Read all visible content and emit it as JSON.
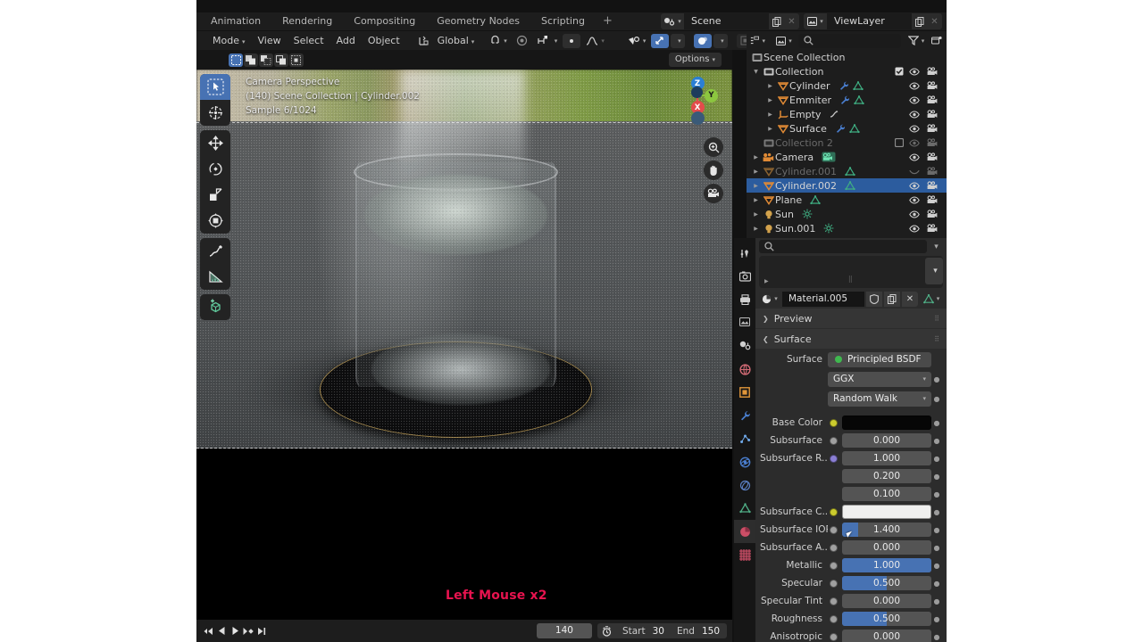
{
  "workspace_tabs": [
    {
      "label": "Animation"
    },
    {
      "label": "Rendering"
    },
    {
      "label": "Compositing"
    },
    {
      "label": "Geometry Nodes"
    },
    {
      "label": "Scripting"
    },
    {
      "label": "+"
    }
  ],
  "scene_selector": {
    "icon": "scene-icon",
    "value": "Scene",
    "new_btn": "copy-icon",
    "unlink_btn": "✕"
  },
  "viewlayer_selector": {
    "icon": "viewlayer-icon",
    "value": "ViewLayer",
    "new_btn": "copy-icon",
    "unlink_btn": "✕"
  },
  "viewport_header": {
    "mode": "Mode",
    "menus": [
      "View",
      "Select",
      "Add",
      "Object"
    ],
    "transform_orientation": "Global",
    "shading_modes": [
      "wireframe",
      "solid",
      "material-preview",
      "rendered"
    ],
    "active_shading": "rendered"
  },
  "tool_header": {
    "select_modes": [
      "set",
      "extend",
      "subtract",
      "invert",
      "intersect"
    ],
    "active_select_mode": "set",
    "options_label": "Options"
  },
  "viewport_overlay": {
    "line1": "Camera Perspective",
    "line2": "(140) Scene Collection | Cylinder.002",
    "line3": "Sample 6/1024"
  },
  "annotation": {
    "text": "Left Mouse x2",
    "color": "#e8134f"
  },
  "gizmo": {
    "axes": [
      "Z",
      "Y",
      "X"
    ],
    "colors": {
      "z": "#2b7fd4",
      "y": "#8cc63f",
      "x": "#e34b4b"
    }
  },
  "toolbar": {
    "tools": [
      {
        "name": "tweak-tool",
        "active": true
      },
      {
        "name": "cursor-tool",
        "active": false
      },
      {
        "name": "move-tool",
        "active": false
      },
      {
        "name": "rotate-tool",
        "active": false
      },
      {
        "name": "scale-tool",
        "active": false
      },
      {
        "name": "transform-tool",
        "active": false
      },
      {
        "name": "annotate-tool",
        "active": false
      },
      {
        "name": "measure-tool",
        "active": false
      },
      {
        "name": "add-cube-tool",
        "active": false
      }
    ]
  },
  "timeline": {
    "buttons": [
      "jump-to-start",
      "play-reverse",
      "play",
      "jump-to-keyframe",
      "jump-to-end"
    ],
    "current_frame": "140",
    "start_label": "Start",
    "start_value": "30",
    "end_label": "End",
    "end_value": "150"
  },
  "outliner": {
    "search_placeholder": "",
    "root": "Scene Collection",
    "rows": [
      {
        "indent": 0,
        "disclosure": "▼",
        "icon": "collection-icon",
        "icon_color": "#c8c8c8",
        "name": "Collection",
        "mods": [],
        "checkbox": true,
        "eye": true,
        "camera": true,
        "dim": false,
        "selected": false
      },
      {
        "indent": 1,
        "disclosure": "▶",
        "icon": "mesh-icon",
        "icon_color": "#e08a35",
        "name": "Cylinder",
        "mods": [
          "modifier-icon",
          "mesh-data-icon"
        ],
        "checkbox": false,
        "eye": true,
        "camera": true,
        "dim": false,
        "selected": false
      },
      {
        "indent": 1,
        "disclosure": "▶",
        "icon": "mesh-icon",
        "icon_color": "#e08a35",
        "name": "Emmiter",
        "mods": [
          "modifier-icon",
          "mesh-data-icon"
        ],
        "checkbox": false,
        "eye": true,
        "camera": true,
        "dim": false,
        "selected": false
      },
      {
        "indent": 1,
        "disclosure": "▶",
        "icon": "empty-icon",
        "icon_color": "#e08a35",
        "name": "Empty",
        "mods": [
          "constraint-icon"
        ],
        "checkbox": false,
        "eye": true,
        "camera": true,
        "dim": false,
        "selected": false
      },
      {
        "indent": 1,
        "disclosure": "▶",
        "icon": "mesh-icon",
        "icon_color": "#e08a35",
        "name": "Surface",
        "mods": [
          "modifier-icon",
          "mesh-data-icon"
        ],
        "checkbox": false,
        "eye": true,
        "camera": true,
        "dim": false,
        "selected": false
      },
      {
        "indent": 0,
        "disclosure": "",
        "icon": "collection-icon",
        "icon_color": "#7a7a7a",
        "name": "Collection 2",
        "mods": [],
        "checkbox": true,
        "eye": true,
        "camera": true,
        "dim": true,
        "selected": false
      },
      {
        "indent": 0,
        "disclosure": "▶",
        "icon": "camera-icon",
        "icon_color": "#e08a35",
        "name": "Camera",
        "mods": [
          "camera-data-icon"
        ],
        "checkbox": false,
        "eye": true,
        "camera": true,
        "dim": false,
        "selected": false
      },
      {
        "indent": 0,
        "disclosure": "▶",
        "icon": "mesh-icon",
        "icon_color": "#8a6230",
        "name": "Cylinder.001",
        "mods": [
          "mesh-data-icon"
        ],
        "checkbox": false,
        "eye": false,
        "camera": true,
        "dim": true,
        "selected": false
      },
      {
        "indent": 0,
        "disclosure": "▶",
        "icon": "mesh-icon",
        "icon_color": "#e08a35",
        "name": "Cylinder.002",
        "mods": [
          "mesh-data-icon"
        ],
        "checkbox": false,
        "eye": true,
        "camera": true,
        "dim": false,
        "selected": true
      },
      {
        "indent": 0,
        "disclosure": "▶",
        "icon": "mesh-icon",
        "icon_color": "#e08a35",
        "name": "Plane",
        "mods": [
          "mesh-data-icon"
        ],
        "checkbox": false,
        "eye": true,
        "camera": true,
        "dim": false,
        "selected": false
      },
      {
        "indent": 0,
        "disclosure": "▶",
        "icon": "light-icon",
        "icon_color": "#d2a24c",
        "name": "Sun",
        "mods": [
          "light-data-icon"
        ],
        "checkbox": false,
        "eye": true,
        "camera": true,
        "dim": false,
        "selected": false
      },
      {
        "indent": 0,
        "disclosure": "▶",
        "icon": "light-icon",
        "icon_color": "#d2a24c",
        "name": "Sun.001",
        "mods": [
          "light-data-icon"
        ],
        "checkbox": false,
        "eye": true,
        "camera": true,
        "dim": false,
        "selected": false
      }
    ]
  },
  "properties": {
    "tabs": [
      {
        "name": "tool-tab",
        "glyph": "⚒",
        "active": false
      },
      {
        "name": "render-tab",
        "glyph": "📷",
        "active": false
      },
      {
        "name": "output-tab",
        "glyph": "🖨",
        "active": false
      },
      {
        "name": "viewlayer-tab",
        "glyph": "❑",
        "active": false
      },
      {
        "name": "scene-tab",
        "glyph": "◑",
        "active": false
      },
      {
        "name": "world-tab",
        "glyph": "●",
        "active": false
      },
      {
        "name": "object-tab",
        "glyph": "▣",
        "active": false
      },
      {
        "name": "modifier-tab",
        "glyph": "🔧",
        "active": false
      },
      {
        "name": "particles-tab",
        "glyph": "⁂",
        "active": false
      },
      {
        "name": "physics-tab",
        "glyph": "⦿",
        "active": false
      },
      {
        "name": "constraint-tab",
        "glyph": "⛓",
        "active": false
      },
      {
        "name": "data-tab",
        "glyph": "▽",
        "active": false
      },
      {
        "name": "material-tab",
        "glyph": "◔",
        "active": true
      },
      {
        "name": "texture-tab",
        "glyph": "▓",
        "active": false
      }
    ],
    "material_name": "Material.005",
    "panels": [
      {
        "label": "Preview",
        "expanded": false
      },
      {
        "label": "Surface",
        "expanded": true
      }
    ],
    "surface_label": "Surface",
    "surface_node": "Principled BSDF",
    "distribution": "GGX",
    "subsurface_method": "Random Walk",
    "inputs": [
      {
        "label": "Base Color",
        "type": "color",
        "value": "#060606",
        "sock": "#cccc2e",
        "slider": 0
      },
      {
        "label": "Subsurface",
        "type": "value",
        "value": "0.000",
        "sock": "#a0a0a0",
        "slider": 0
      },
      {
        "label": "Subsurface R...",
        "type": "value",
        "value": "1.000",
        "sock": "#8b7fd4",
        "slider": 0
      },
      {
        "label": "",
        "type": "value",
        "value": "0.200",
        "sock": "",
        "slider": 0
      },
      {
        "label": "",
        "type": "value",
        "value": "0.100",
        "sock": "",
        "slider": 0
      },
      {
        "label": "Subsurface C...",
        "type": "color",
        "value": "#f0f0ef",
        "sock": "#cccc2e",
        "slider": 0
      },
      {
        "label": "Subsurface IOR",
        "type": "value",
        "value": "1.400",
        "sock": "#a0a0a0",
        "slider": 18
      },
      {
        "label": "Subsurface A...",
        "type": "value",
        "value": "0.000",
        "sock": "#a0a0a0",
        "slider": 0
      },
      {
        "label": "Metallic",
        "type": "value",
        "value": "1.000",
        "sock": "#a0a0a0",
        "slider": 100
      },
      {
        "label": "Specular",
        "type": "value",
        "value": "0.500",
        "sock": "#a0a0a0",
        "slider": 50
      },
      {
        "label": "Specular Tint",
        "type": "value",
        "value": "0.000",
        "sock": "#a0a0a0",
        "slider": 0
      },
      {
        "label": "Roughness",
        "type": "value",
        "value": "0.500",
        "sock": "#a0a0a0",
        "slider": 50
      },
      {
        "label": "Anisotropic",
        "type": "value",
        "value": "0.000",
        "sock": "#a0a0a0",
        "slider": 0
      }
    ]
  }
}
